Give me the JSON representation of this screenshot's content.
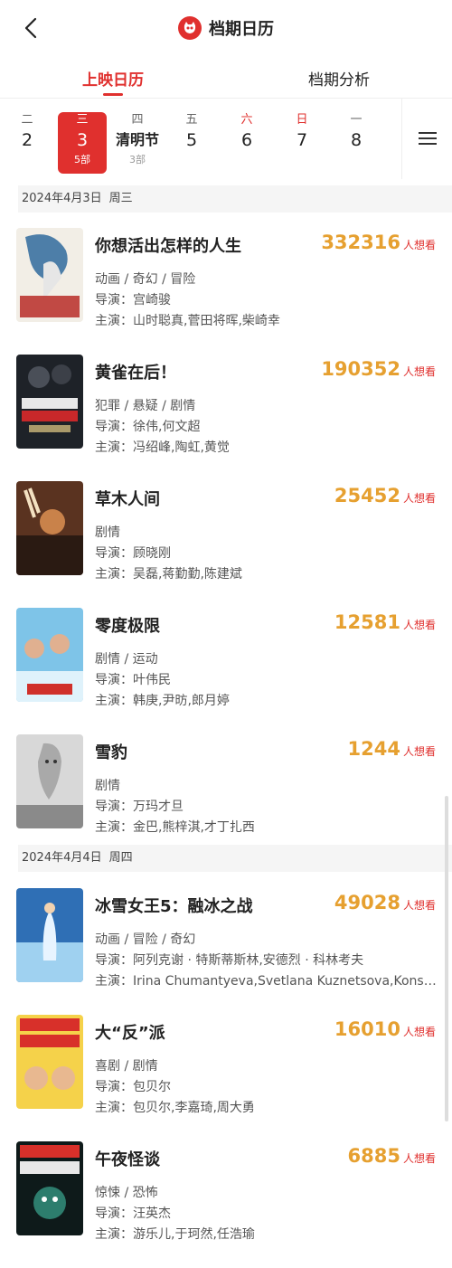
{
  "header": {
    "title": "档期日历",
    "back_icon": "chevron-left-icon",
    "logo_icon": "cat-logo-icon",
    "accent": "#e0302e"
  },
  "tabs": [
    {
      "label": "上映日历",
      "active": true
    },
    {
      "label": "档期分析",
      "active": false
    }
  ],
  "dates": [
    {
      "weekday": "二",
      "day": "2",
      "count": ""
    },
    {
      "weekday": "三",
      "day": "3",
      "count": "5部",
      "selected": true
    },
    {
      "weekday": "四",
      "day": "清明节",
      "count": "3部"
    },
    {
      "weekday": "五",
      "day": "5",
      "count": ""
    },
    {
      "weekday": "六",
      "day": "6",
      "count": "",
      "weekend": true
    },
    {
      "weekday": "日",
      "day": "7",
      "count": "",
      "weekend": true
    },
    {
      "weekday": "一",
      "day": "8",
      "count": ""
    }
  ],
  "sections": [
    {
      "date": "2024年4月3日",
      "weekday": "周三"
    },
    {
      "date": "2024年4月4日",
      "weekday": "周四"
    }
  ],
  "want_label": "人想看",
  "movies": [
    {
      "title": "你想活出怎样的人生",
      "want": "332316",
      "genre": "动画 / 奇幻 / 冒险",
      "director": "导演：宫崎骏",
      "cast": "主演：山时聪真,菅田将晖,柴崎幸"
    },
    {
      "title": "黄雀在后！",
      "want": "190352",
      "genre": "犯罪 / 悬疑 / 剧情",
      "director": "导演：徐伟,何文超",
      "cast": "主演：冯绍峰,陶虹,黄觉"
    },
    {
      "title": "草木人间",
      "want": "25452",
      "genre": "剧情",
      "director": "导演：顾晓刚",
      "cast": "主演：吴磊,蒋勤勤,陈建斌"
    },
    {
      "title": "零度极限",
      "want": "12581",
      "genre": "剧情 / 运动",
      "director": "导演：叶伟民",
      "cast": "主演：韩庚,尹昉,郎月婷"
    },
    {
      "title": "雪豹",
      "want": "1244",
      "genre": "剧情",
      "director": "导演：万玛才旦",
      "cast": "主演：金巴,熊梓淇,才丁扎西"
    },
    {
      "title": "冰雪女王5：融冰之战",
      "want": "49028",
      "genre": "动画 / 冒险 / 奇幻",
      "director": "导演：阿列克谢 · 特斯蒂斯林,安德烈 · 科林考夫",
      "cast": "主演：Irina Chumantyeva,Svetlana Kuznetsova,Konstantin..."
    },
    {
      "title": "大“反”派",
      "want": "16010",
      "genre": "喜剧 / 剧情",
      "director": "导演：包贝尔",
      "cast": "主演：包贝尔,李嘉琦,周大勇"
    },
    {
      "title": "午夜怪谈",
      "want": "6885",
      "genre": "惊悚 / 恐怖",
      "director": "导演：汪英杰",
      "cast": "主演：游乐儿,于珂然,任浩瑜"
    }
  ]
}
